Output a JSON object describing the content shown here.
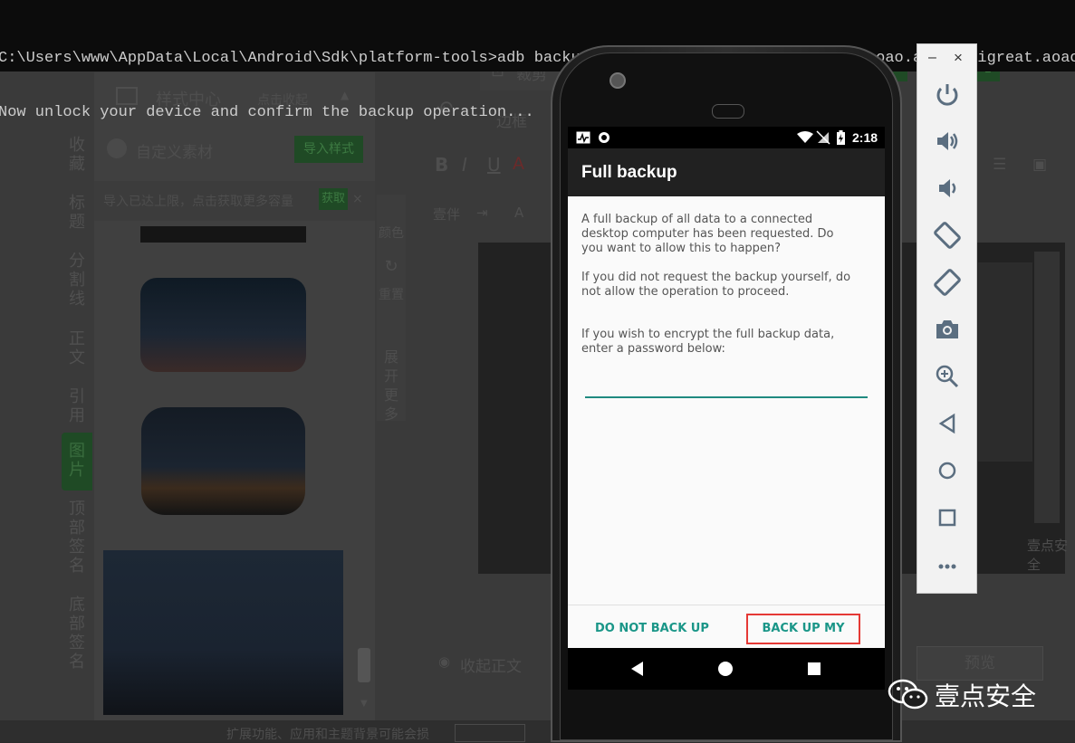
{
  "terminal": {
    "line1": "C:\\Users\\www\\AppData\\Local\\Android\\Sdk\\platform-tools>adb backup -nosystem -apk -f com.igreat.aoao.ab com.igreat.aoao",
    "line2": "Now unlock your device and confirm the backup operation..."
  },
  "editor": {
    "style_center_title": "样式中心",
    "collapse_label": "点击收起",
    "crop_label": "裁剪",
    "border_select": "边框",
    "custom_material": "自定义素材",
    "import_style_button": "导入样式",
    "limit_notice": "导入已达上限，点击获取更多容量",
    "obtain_button": "获取",
    "font_label": "壹伴",
    "color_label": "颜色",
    "reset_label": "重置",
    "expand_label": "展开更多",
    "collapse_body": "收起正文",
    "preview_button": "预览",
    "extension_notice": "扩展功能、应用和主题背景可能会损",
    "vertical_tabs": [
      "收藏",
      "标题",
      "分割线",
      "正文",
      "引用",
      "图片",
      "顶部签名",
      "底部签名"
    ],
    "active_tab_index": 5
  },
  "phone": {
    "status_time": "2:18",
    "app_title": "Full backup",
    "paragraph1": "A full backup of all data to a connected desktop computer has been requested. Do you want to allow this to happen?",
    "paragraph2": "If you did not request the backup yourself, do not allow the operation to proceed.",
    "paragraph3": "If you wish to encrypt the full backup data, enter a password below:",
    "password_value": "",
    "deny_button": "DO NOT BACK UP",
    "confirm_button": "BACK UP MY DATA",
    "highlight_color": "#e53935",
    "accent_color": "#1a9688"
  },
  "emulator_toolbar": {
    "minimize_glyph": "–",
    "close_glyph": "×",
    "tools": [
      "power-icon",
      "volume-up-icon",
      "volume-down-icon",
      "rotate-left-icon",
      "rotate-right-icon",
      "camera-icon",
      "zoom-icon",
      "back-icon",
      "home-icon",
      "overview-icon",
      "more-icon"
    ]
  },
  "watermark": {
    "text": "壹点安全"
  }
}
